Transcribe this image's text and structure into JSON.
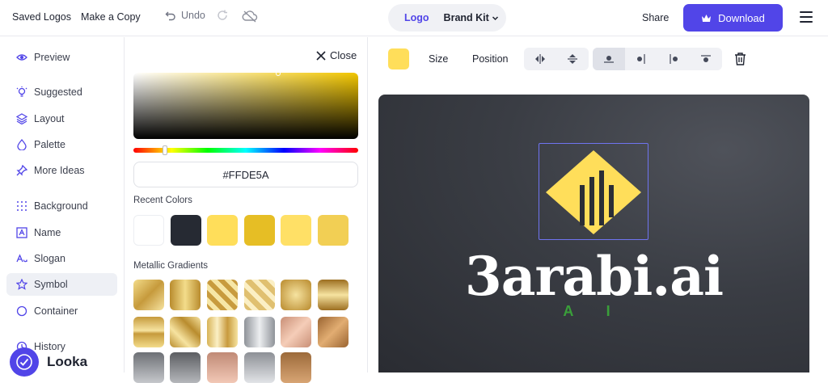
{
  "topbar": {
    "saved_logos": "Saved Logos",
    "make_copy": "Make a Copy",
    "undo": "Undo",
    "logo_tab": "Logo",
    "brand_kit": "Brand Kit",
    "share": "Share",
    "download": "Download"
  },
  "nav": {
    "items": [
      {
        "label": "Preview",
        "icon": "eye-icon"
      },
      {
        "label": "Suggested",
        "icon": "bulb-icon"
      },
      {
        "label": "Layout",
        "icon": "layers-icon"
      },
      {
        "label": "Palette",
        "icon": "drop-icon"
      },
      {
        "label": "More Ideas",
        "icon": "pin-icon"
      },
      {
        "label": "Background",
        "icon": "grid-icon"
      },
      {
        "label": "Name",
        "icon": "text-box-icon"
      },
      {
        "label": "Slogan",
        "icon": "font-icon"
      },
      {
        "label": "Symbol",
        "icon": "star-icon"
      },
      {
        "label": "Container",
        "icon": "circle-icon"
      },
      {
        "label": "History",
        "icon": "clock-icon"
      }
    ],
    "active": "Symbol",
    "brand": "Looka"
  },
  "color_panel": {
    "close": "Close",
    "hex_value": "#FFDE5A",
    "recent_label": "Recent Colors",
    "recent_colors": [
      "#FFFFFF",
      "#262A33",
      "#FFDE5A",
      "#E6BE25",
      "#FFE066",
      "#F2CF54"
    ],
    "metallic_label": "Metallic Gradients"
  },
  "toolbar": {
    "current_color": "#FFDE5A",
    "size": "Size",
    "position": "Position"
  },
  "canvas": {
    "logo_name": "3arabi.ai",
    "slogan": "A I",
    "symbol_color": "#FFDE5A",
    "bars_color": "#2B2E36"
  }
}
